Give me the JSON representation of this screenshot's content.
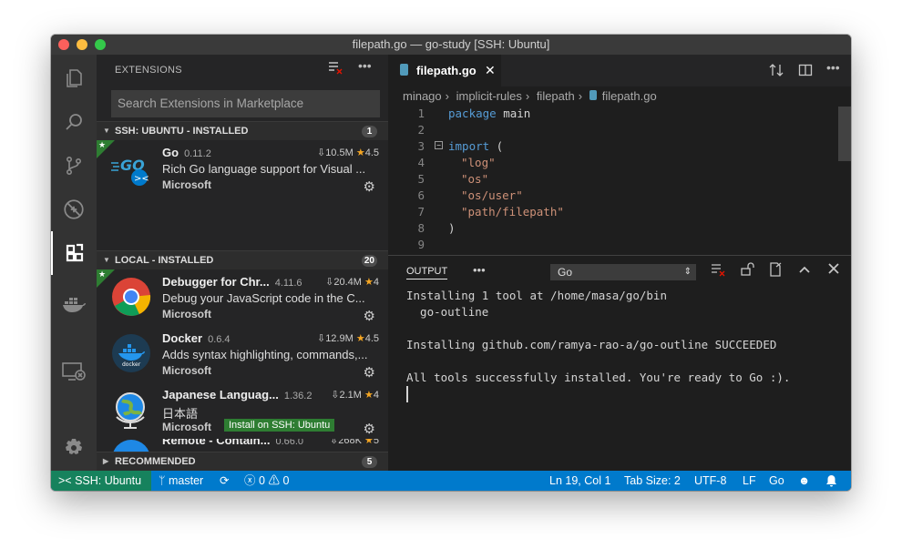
{
  "window": {
    "title": "filepath.go — go-study [SSH: Ubuntu]"
  },
  "sidebar": {
    "title": "EXTENSIONS",
    "search_placeholder": "Search Extensions in Marketplace",
    "sections": [
      {
        "label": "SSH: UBUNTU - INSTALLED",
        "count": "1"
      },
      {
        "label": "LOCAL - INSTALLED",
        "count": "20"
      },
      {
        "label": "RECOMMENDED",
        "count": "5"
      }
    ],
    "ssh_extensions": [
      {
        "name": "Go",
        "version": "0.11.2",
        "downloads": "10.5M",
        "rating": "4.5",
        "description": "Rich Go language support for Visual ...",
        "publisher": "Microsoft"
      }
    ],
    "local_extensions": [
      {
        "name": "Debugger for Chr...",
        "version": "4.11.6",
        "downloads": "20.4M",
        "rating": "4",
        "description": "Debug your JavaScript code in the C...",
        "publisher": "Microsoft"
      },
      {
        "name": "Docker",
        "version": "0.6.4",
        "downloads": "12.9M",
        "rating": "4.5",
        "description": "Adds syntax highlighting, commands,...",
        "publisher": "Microsoft"
      },
      {
        "name": "Japanese Languag...",
        "version": "1.36.2",
        "downloads": "2.1M",
        "rating": "4",
        "description": "日本語",
        "publisher": "Microsoft",
        "action": "Install on SSH: Ubuntu"
      },
      {
        "name": "Remote - Contain...",
        "version": "0.66.0",
        "downloads": "268K",
        "rating": "5"
      }
    ]
  },
  "editor": {
    "tab": {
      "label": "filepath.go"
    },
    "breadcrumb": [
      "minago",
      "implicit-rules",
      "filepath",
      "filepath.go"
    ],
    "line_numbers": [
      "1",
      "2",
      "3",
      "4",
      "5",
      "6",
      "7",
      "8",
      "9"
    ],
    "code": {
      "l1_kw": "package",
      "l1_rest": " main",
      "l3_kw": "import",
      "l3_rest": " (",
      "l4": "\"log\"",
      "l5": "\"os\"",
      "l6": "\"os/user\"",
      "l7": "\"path/filepath\"",
      "l8": ")"
    }
  },
  "panel": {
    "title": "OUTPUT",
    "channel": "Go",
    "lines": [
      "Installing 1 tool at /home/masa/go/bin",
      "  go-outline",
      "",
      "Installing github.com/ramya-rao-a/go-outline SUCCEEDED",
      "",
      "All tools successfully installed. You're ready to Go :)."
    ]
  },
  "statusbar": {
    "remote": "SSH: Ubuntu",
    "branch": "master",
    "errors": "0",
    "warnings": "0",
    "position": "Ln 19, Col 1",
    "tab_size": "Tab Size: 2",
    "encoding": "UTF-8",
    "eol": "LF",
    "language": "Go"
  },
  "colors": {
    "statusbar": "#007acc",
    "remote": "#16825d",
    "star": "#f5a623"
  }
}
